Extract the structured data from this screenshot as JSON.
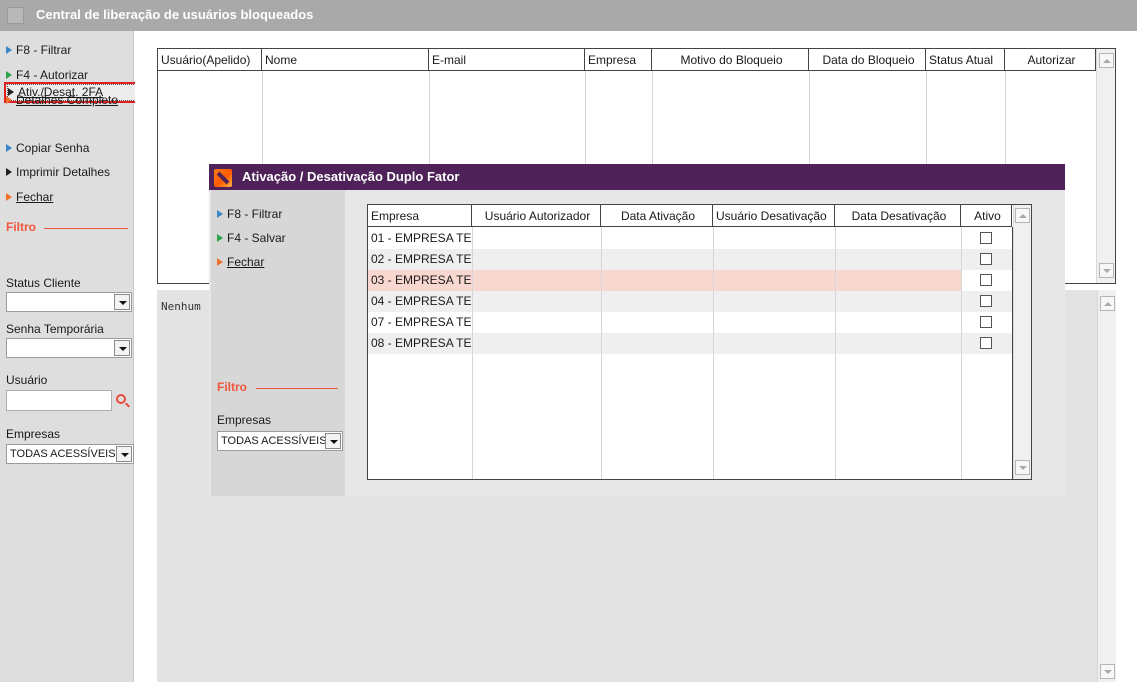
{
  "window": {
    "title": "Central de liberação de usuários bloqueados"
  },
  "sidebar": {
    "menu": [
      {
        "label": "F8 - Filtrar",
        "icon": "blue-triangle-icon"
      },
      {
        "label": "F4 - Autorizar",
        "icon": "green-triangle-icon"
      },
      {
        "label": "Detalhes Completo",
        "icon": "orange-triangle-icon"
      },
      {
        "label": "Ativ./Desat. 2FA",
        "icon": "black-triangle-icon"
      },
      {
        "label": "Copiar Senha",
        "icon": "blue-triangle-icon"
      },
      {
        "label": "Imprimir Detalhes",
        "icon": "black-triangle-icon"
      },
      {
        "label": "Fechar",
        "icon": "orange-triangle-icon"
      }
    ],
    "filter_title": "Filtro",
    "status_cliente_label": "Status Cliente",
    "status_cliente_value": "",
    "senha_temporaria_label": "Senha Temporária",
    "senha_temporaria_value": "",
    "usuario_label": "Usuário",
    "usuario_value": "",
    "empresas_label": "Empresas",
    "empresas_value": "TODAS ACESSÍVEIS"
  },
  "main_grid": {
    "columns": [
      "Usuário(Apelido)",
      "Nome",
      "E-mail",
      "Empresa",
      "Motivo do Bloqueio",
      "Data do Bloqueio",
      "Status Atual",
      "Autorizar"
    ]
  },
  "detail_panel": {
    "text": "Nenhum"
  },
  "dialog": {
    "title": "Ativação / Desativação Duplo Fator",
    "menu": [
      {
        "label": "F8 - Filtrar",
        "icon": "blue-triangle-icon"
      },
      {
        "label": "F4 - Salvar",
        "icon": "green-triangle-icon"
      },
      {
        "label": "Fechar",
        "icon": "orange-triangle-icon"
      }
    ],
    "filter_title": "Filtro",
    "empresas_label": "Empresas",
    "empresas_value": "TODAS ACESSÍVEIS",
    "grid": {
      "columns": [
        "Empresa",
        "Usuário Autorizador",
        "Data Ativação",
        "Usuário Desativação",
        "Data Desativação",
        "Ativo"
      ],
      "rows": [
        {
          "empresa": "01 - EMPRESA TE",
          "ativo": false
        },
        {
          "empresa": "02 - EMPRESA TE",
          "ativo": false
        },
        {
          "empresa": "03 - EMPRESA TE",
          "ativo": false,
          "highlighted": true
        },
        {
          "empresa": "04 - EMPRESA TE",
          "ativo": false
        },
        {
          "empresa": "07 - EMPRESA TE",
          "ativo": false
        },
        {
          "empresa": "08 - EMPRESA TE",
          "ativo": false
        }
      ]
    }
  },
  "colors": {
    "dialog_title_bg": "#4e2258",
    "filter_accent": "#f0563b",
    "highlight_row": "#f8d7d0",
    "selection_outline": "#e02020"
  }
}
